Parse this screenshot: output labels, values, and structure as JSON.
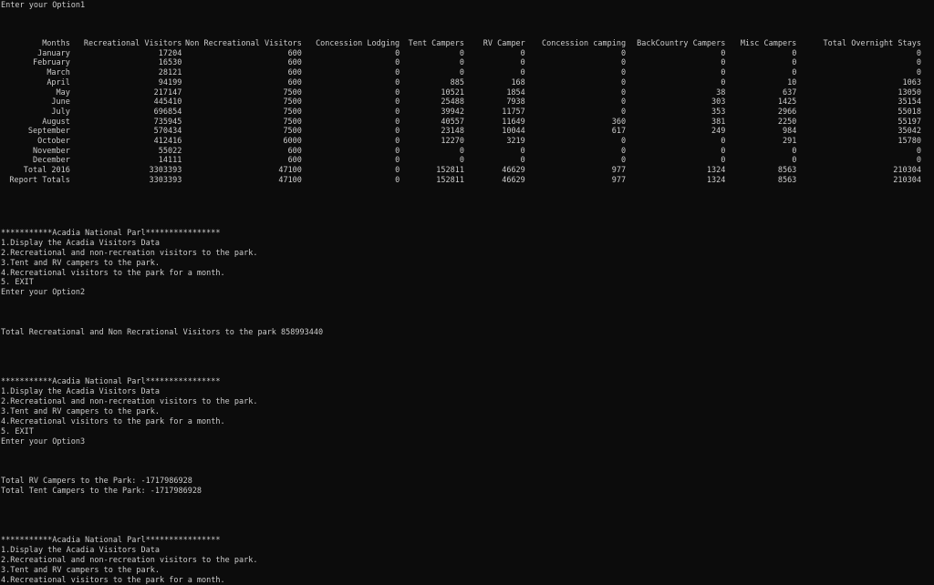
{
  "prompt_option1": "Enter your Option1",
  "table": {
    "headers": [
      "Months",
      "Recreational Visitors",
      "Non Recreational Visitors",
      "Concession Lodging",
      "Tent Campers",
      "RV Camper",
      "Concession camping",
      "BackCountry Campers",
      "Misc Campers",
      "Total Overnight Stays"
    ],
    "rows": [
      [
        "January",
        "17204",
        "600",
        "0",
        "0",
        "0",
        "0",
        "0",
        "0",
        "0"
      ],
      [
        "February",
        "16530",
        "600",
        "0",
        "0",
        "0",
        "0",
        "0",
        "0",
        "0"
      ],
      [
        "March",
        "28121",
        "600",
        "0",
        "0",
        "0",
        "0",
        "0",
        "0",
        "0"
      ],
      [
        "April",
        "94199",
        "600",
        "0",
        "885",
        "168",
        "0",
        "0",
        "10",
        "1063"
      ],
      [
        "May",
        "217147",
        "7500",
        "0",
        "10521",
        "1854",
        "0",
        "38",
        "637",
        "13050"
      ],
      [
        "June",
        "445410",
        "7500",
        "0",
        "25488",
        "7938",
        "0",
        "303",
        "1425",
        "35154"
      ],
      [
        "July",
        "696854",
        "7500",
        "0",
        "39942",
        "11757",
        "0",
        "353",
        "2966",
        "55018"
      ],
      [
        "August",
        "735945",
        "7500",
        "0",
        "40557",
        "11649",
        "360",
        "381",
        "2250",
        "55197"
      ],
      [
        "September",
        "570434",
        "7500",
        "0",
        "23148",
        "10044",
        "617",
        "249",
        "984",
        "35042"
      ],
      [
        "October",
        "412416",
        "6000",
        "0",
        "12270",
        "3219",
        "0",
        "0",
        "291",
        "15780"
      ],
      [
        "November",
        "55022",
        "600",
        "0",
        "0",
        "0",
        "0",
        "0",
        "0",
        "0"
      ],
      [
        "December",
        "14111",
        "600",
        "0",
        "0",
        "0",
        "0",
        "0",
        "0",
        "0"
      ],
      [
        "Total 2016",
        "3303393",
        "47100",
        "0",
        "152811",
        "46629",
        "977",
        "1324",
        "8563",
        "210304"
      ],
      [
        "Report Totals",
        "3303393",
        "47100",
        "0",
        "152811",
        "46629",
        "977",
        "1324",
        "8563",
        "210304"
      ]
    ]
  },
  "menu": {
    "title": "***********Acadia National Parl****************",
    "item1": "1.Display the Acadia Visitors Data",
    "item2": "2.Recreational and non-recreation visitors to the park.",
    "item3": "3.Tent and RV campers to the park.",
    "item4": "4.Recreational visitors to the park for a month.",
    "item5": "5. EXIT"
  },
  "prompt_option2": "Enter your Option2",
  "result_total_visitors": "Total Recreational and Non Recrational Visitors to the park 858993440",
  "prompt_option3": "Enter your Option3",
  "result_rv": "Total RV Campers to the Park: -1717986928",
  "result_tent": "Total Tent Campers to the Park: -1717986928"
}
